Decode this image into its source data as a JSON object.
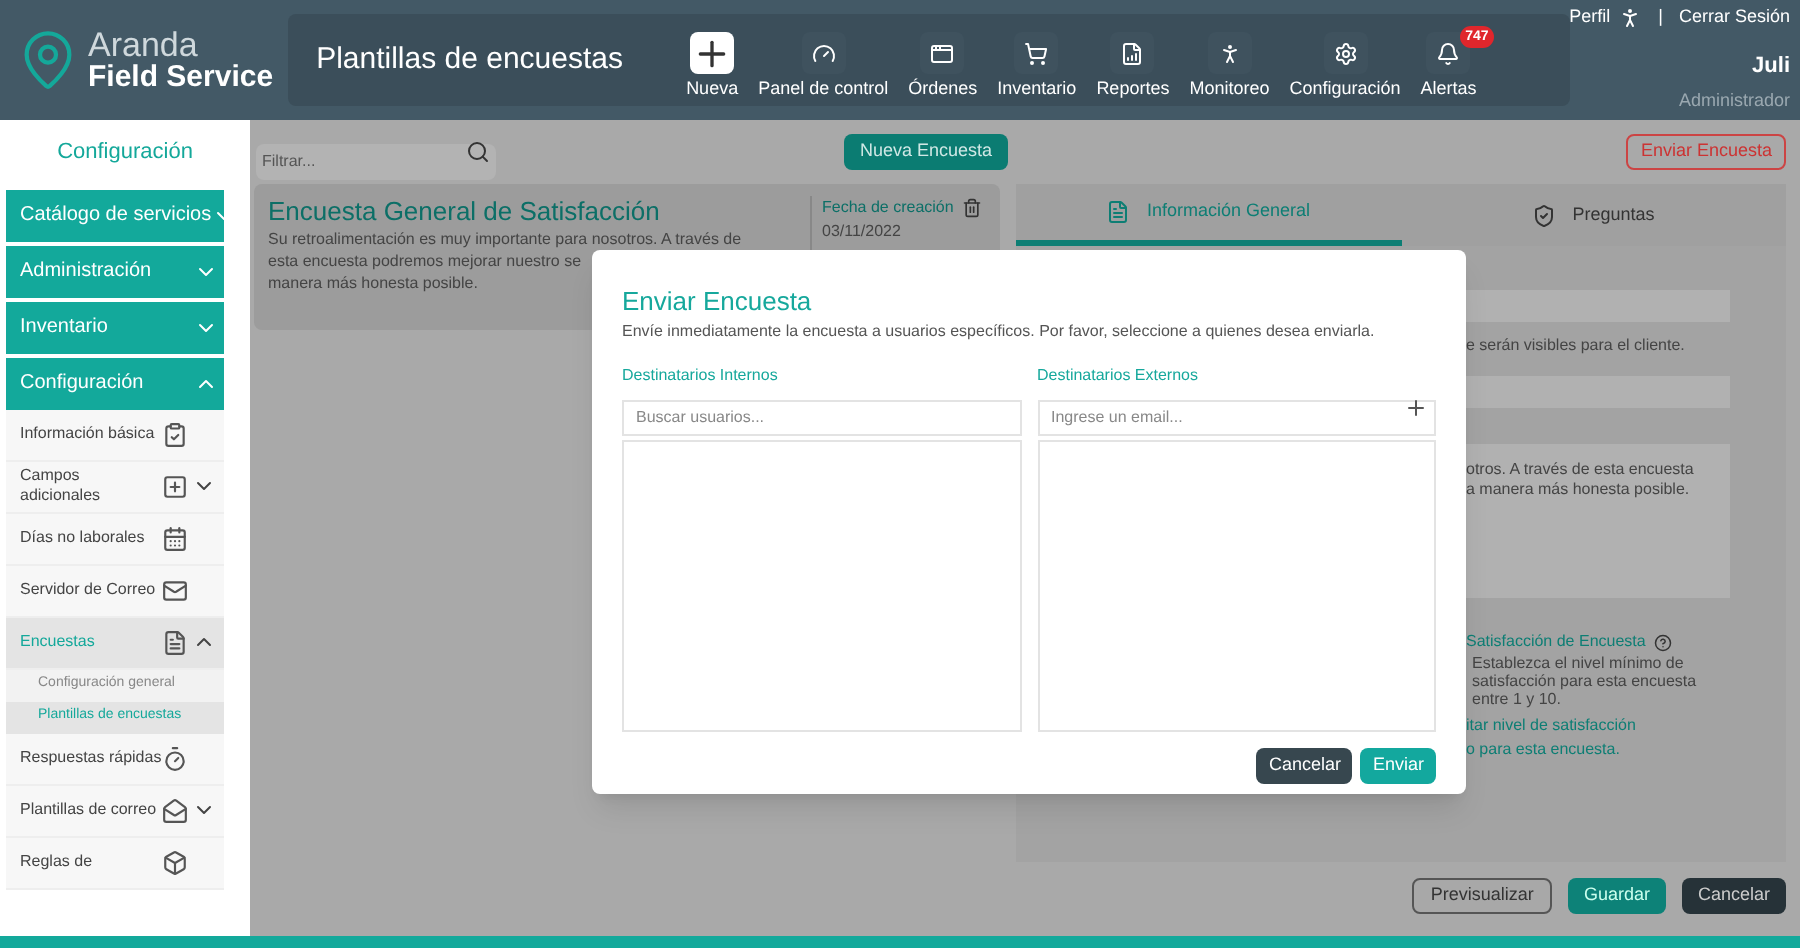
{
  "header": {
    "brand_top": "Aranda",
    "brand_bottom": "Field Service",
    "page_title": "Plantillas de encuestas",
    "nav": [
      {
        "label": "Nueva",
        "kind": "new"
      },
      {
        "label": "Panel de control",
        "kind": "gauge"
      },
      {
        "label": "Órdenes",
        "kind": "window"
      },
      {
        "label": "Inventario",
        "kind": "cart"
      },
      {
        "label": "Reportes",
        "kind": "report"
      },
      {
        "label": "Monitoreo",
        "kind": "monitor"
      },
      {
        "label": "Configuración",
        "kind": "gear"
      },
      {
        "label": "Alertas",
        "kind": "bell",
        "badge": "747"
      }
    ],
    "profile": "Perfil",
    "separator": "|",
    "logout": "Cerrar Sesión",
    "user": "Juli",
    "role": "Administrador"
  },
  "sidebar": {
    "title": "Configuración",
    "sections": [
      {
        "label": "Catálogo de servicios",
        "expanded": false
      },
      {
        "label": "Administración",
        "expanded": false
      },
      {
        "label": "Inventario",
        "expanded": false
      },
      {
        "label": "Configuración",
        "expanded": true,
        "children": [
          {
            "label": "Información básica",
            "selected": false
          },
          {
            "label": "Campos adicionales",
            "selected": false,
            "expanded": false
          },
          {
            "label": "Días no laborales",
            "selected": false
          },
          {
            "label": "Servidor de Correo",
            "selected": false
          },
          {
            "label": "Encuestas",
            "selected": true,
            "expanded": true,
            "children": [
              {
                "label": "Configuración general",
                "selected": false
              },
              {
                "label": "Plantillas de encuestas",
                "selected": true
              }
            ]
          },
          {
            "label": "Respuestas rápidas",
            "selected": false
          },
          {
            "label": "Plantillas de correo",
            "selected": false,
            "expanded": false
          },
          {
            "label": "Reglas de",
            "selected": false
          }
        ]
      }
    ]
  },
  "toolbar": {
    "filter_placeholder": "Filtrar...",
    "new_button": "Nueva Encuesta",
    "send_button": "Enviar Encuesta"
  },
  "survey_card": {
    "title": "Encuesta General de Satisfacción",
    "description_lines": [
      "Su retroalimentación es muy importante para nosotros. A través de",
      "esta encuesta podremos mejorar nuestro se",
      "manera más honesta posible."
    ],
    "date_label": "Fecha de creación",
    "date": "03/11/2022"
  },
  "detail_tabs": [
    {
      "label": "Información General",
      "selected": true
    },
    {
      "label": "Preguntas",
      "selected": false
    }
  ],
  "detail": {
    "hint": "e serán visibles para el cliente.",
    "description_lines": [
      "otros. A través de esta encuesta",
      "a manera más honesta posible."
    ],
    "satisfaction_title": "Satisfacción de Encuesta",
    "satisfaction_help": "Establezca el nivel mínimo de satisfacción para esta encuesta entre 1 y 10.",
    "link_lines": [
      "itar nivel de satisfacción",
      "o para esta encuesta."
    ]
  },
  "footer_buttons": [
    {
      "label": "Previsualizar",
      "kind": "outline"
    },
    {
      "label": "Guardar",
      "kind": "primary"
    },
    {
      "label": "Cancelar",
      "kind": "dark"
    }
  ],
  "dialog": {
    "title": "Enviar Encuesta",
    "description": "Envíe inmediatamente la encuesta a usuarios específicos. Por favor, seleccione a quienes desea enviarla.",
    "internal_label": "Destinatarios Internos",
    "internal_placeholder": "Buscar usuarios...",
    "external_label": "Destinatarios Externos",
    "external_placeholder": "Ingrese un email...",
    "buttons": [
      {
        "label": "Cancelar",
        "kind": "dark"
      },
      {
        "label": "Enviar",
        "kind": "primary"
      }
    ]
  }
}
